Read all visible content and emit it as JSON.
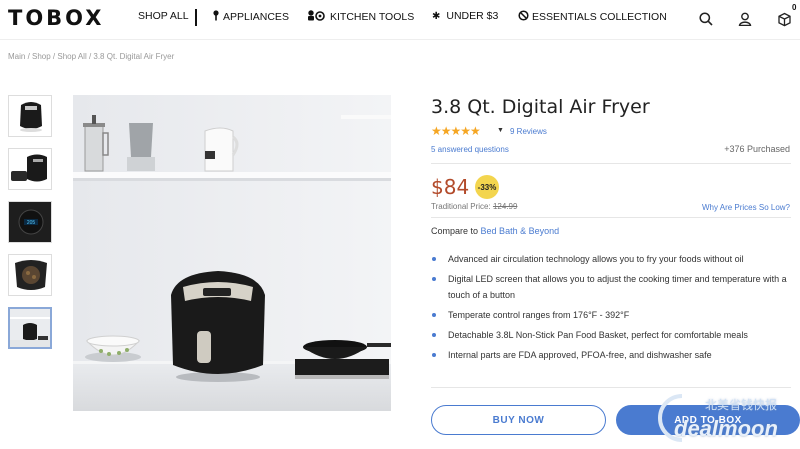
{
  "header": {
    "logo": "TOBOX",
    "nav": {
      "shop_all": "SHOP ALL",
      "appliances": "APPLIANCES",
      "kitchen_tools": "KITCHEN TOOLS",
      "under_3": "UNDER $3",
      "essentials": "ESSENTIALS COLLECTION"
    },
    "icons": [
      "search-icon",
      "user-icon",
      "cart-icon"
    ],
    "cart_count": "0"
  },
  "breadcrumb": "Main / Shop / Shop All / 3.8 Qt. Digital Air Fryer",
  "gallery": {
    "thumb_count": 5,
    "active_index": 4
  },
  "product": {
    "title": "3.8 Qt. Digital Air Fryer",
    "stars": "★★★★★",
    "rating_of_5": 5,
    "reviews": "9 Reviews",
    "answered": "5 answered questions",
    "purchased": "+376 Purchased",
    "price": "$84",
    "discount": "-33%",
    "traditional_label": "Traditional Price:",
    "traditional_price": "124.99",
    "why_link": "Why Are Prices So Low?",
    "compare_prefix": "Compare to",
    "compare_store": "Bed Bath & Beyond",
    "features": [
      "Advanced air circulation technology allows you to fry your foods without oil",
      "Digital LED screen that allows you to adjust the cooking timer and temperature with a touch of a button",
      "Temperate control ranges from 176°F - 392°F",
      "Detachable 3.8L Non-Stick Pan Food Basket, perfect for comfortable meals",
      "Internal parts are FDA approved, PFOA-free, and dishwasher safe"
    ],
    "buy_now": "BUY NOW",
    "add_to_box": "ADD TO BOX"
  },
  "watermark": {
    "cn": "北美省钱快报",
    "en": "dealmoon"
  },
  "colors": {
    "accent": "#4a7bd0",
    "price": "#b24a2a",
    "badge": "#f3d54e",
    "stars": "#f5a623"
  }
}
